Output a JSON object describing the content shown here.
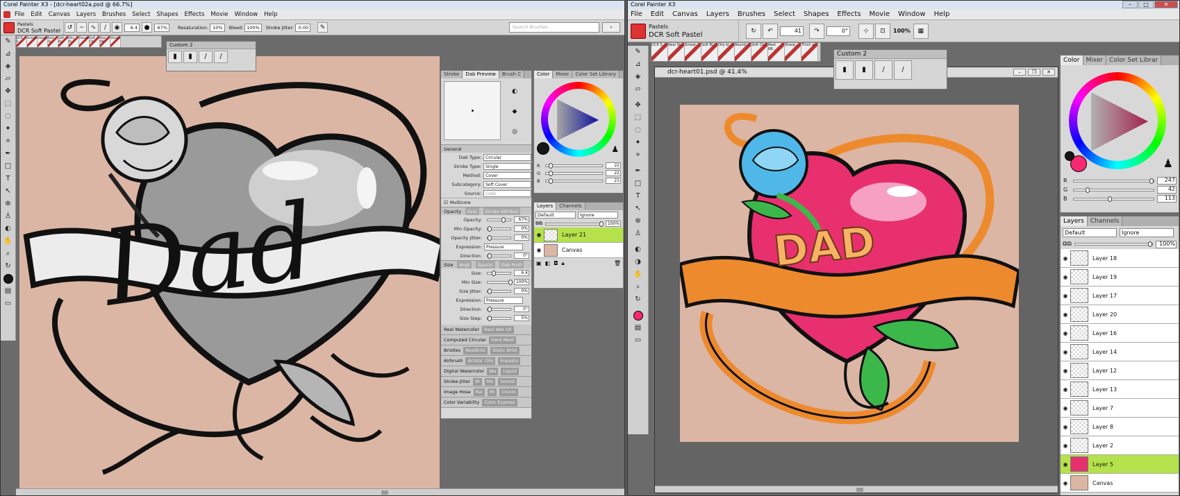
{
  "left_window": {
    "title": "Corel Painter X3 - [dcr-heart02a.psd @ 66.7%]",
    "menu": [
      "File",
      "Edit",
      "Canvas",
      "Layers",
      "Brushes",
      "Select",
      "Shapes",
      "Effects",
      "Movie",
      "Window",
      "Help"
    ],
    "brush_category": "Pastels",
    "brush_variant": "DCR Soft Pastel",
    "property_bar": {
      "size": "6.4",
      "opacity": "67%",
      "resaturation_label": "Resaturation:",
      "resaturation": "10%",
      "bleed_label": "Bleed:",
      "bleed": "100%",
      "stroke_jitter_label": "Stroke Jitter:",
      "stroke_jitter": "0.00"
    },
    "search_placeholder": "Search Brushes",
    "brush_strip": [
      "DCR S...",
      "Scissors",
      "Smear",
      "Real St...",
      "Soft Bl...",
      "Oily bl...",
      "Round...",
      "Soft Ch...",
      "Real 6B...",
      "Sharp..."
    ],
    "custom_palette_title": "Custom 2",
    "canvas_text": "Dad",
    "canvas_bg": "#dcb6a4",
    "brush_control_tabs": [
      "Stroke",
      "Dab Preview",
      "Brush C"
    ],
    "general": {
      "title": "General",
      "rows": [
        {
          "label": "Dab Type:",
          "value": "Circular"
        },
        {
          "label": "Stroke Type:",
          "value": "Single"
        },
        {
          "label": "Method:",
          "value": "Cover"
        },
        {
          "label": "Subcategory:",
          "value": "Soft Cover"
        },
        {
          "label": "Source:",
          "value": "Color"
        }
      ],
      "multicore": "Multicore"
    },
    "opacity_section": {
      "tabs": [
        "Opacity",
        "Grai",
        "Stroke Attribut"
      ],
      "rows": [
        {
          "label": "Opacity:",
          "value": "67%",
          "pos": 0.67
        },
        {
          "label": "Min Opacity:",
          "value": "0%",
          "pos": 0
        },
        {
          "label": "Opacity Jitter:",
          "value": "0%",
          "pos": 0
        }
      ],
      "expression_label": "Expression:",
      "expression": "Pressure",
      "direction_label": "Direction:",
      "direction": "0°"
    },
    "size_section": {
      "tabs": [
        "Size",
        "Angl",
        "Spacin",
        "Dab Profi"
      ],
      "rows": [
        {
          "label": "Size:",
          "value": "6.4",
          "pos": 0.2
        },
        {
          "label": "Min Size:",
          "value": "100%",
          "pos": 1
        },
        {
          "label": "Size Jitter:",
          "value": "0%",
          "pos": 0
        }
      ],
      "expression_label": "Expression:",
      "expression": "Pressure",
      "direction_label": "Direction:",
      "direction": "0°",
      "size_step_label": "Size Step:",
      "size_step": "5%"
    },
    "collapsed_sections": [
      [
        "Real Watercolor",
        "Real Wet Oil"
      ],
      [
        "Computed Circular",
        "Hard Medi"
      ],
      [
        "Bristles",
        "RealBrist",
        "Static Brist"
      ],
      [
        "Airbrush",
        "Artists' Oils",
        "Impasto"
      ],
      [
        "Digital Watercolor",
        "Wa",
        "Liquid"
      ],
      [
        "Stroke Jitter",
        "W",
        "Mo",
        "Smoot"
      ],
      [
        "Image Hose",
        "Ral",
        "Mi",
        "Clonin"
      ],
      [
        "Color Variability",
        "Color Express"
      ]
    ],
    "color_tabs": [
      "Color",
      "Mixer",
      "Color Set Library"
    ],
    "rgb": {
      "r": "22",
      "g": "22",
      "b": "21"
    },
    "layers_tabs": [
      "Layers",
      "Channels"
    ],
    "composite_method": "Default",
    "composite_depth": "Ignore",
    "layer_opacity": "100%",
    "layers": [
      {
        "name": "Layer 21",
        "selected": true
      },
      {
        "name": "Canvas",
        "selected": false
      }
    ]
  },
  "right_window": {
    "title": "Corel Painter X3",
    "menu": [
      "File",
      "Edit",
      "Canvas",
      "Layers",
      "Brushes",
      "Select",
      "Shapes",
      "Effects",
      "Movie",
      "Window",
      "Help"
    ],
    "brush_category": "Pastels",
    "brush_variant": "DCR Soft Pastel",
    "property_bar": {
      "angle1": "41",
      "angle2": "0°",
      "zoom": "100%"
    },
    "brush_strip": [
      "DCR S...",
      "Real St...",
      "Smear",
      "Soft Bl...",
      "Oily bl...",
      "Round...",
      "Soft Ch...",
      "Real 6B...",
      "Sharp...",
      "Thick a..."
    ],
    "custom_palette_title": "Custom 2",
    "doc_title": "dcr-heart01.psd @ 41.4%",
    "canvas_text": "DAD",
    "canvas_bg": "#dcb6a4",
    "color_tabs": [
      "Color",
      "Mixer",
      "Color Set Librar"
    ],
    "rgb": {
      "r": "247",
      "g": "42",
      "b": "113"
    },
    "layers_tabs": [
      "Layers",
      "Channels"
    ],
    "composite_method": "Default",
    "composite_depth": "Ignore",
    "layer_opacity": "100%",
    "layers": [
      {
        "name": "Layer 18",
        "selected": false
      },
      {
        "name": "Layer 19",
        "selected": false
      },
      {
        "name": "Layer 17",
        "selected": false
      },
      {
        "name": "Layer 20",
        "selected": false
      },
      {
        "name": "Layer 16",
        "selected": false
      },
      {
        "name": "Layer 14",
        "selected": false
      },
      {
        "name": "Layer 12",
        "selected": false
      },
      {
        "name": "Layer 13",
        "selected": false
      },
      {
        "name": "Layer 7",
        "selected": false
      },
      {
        "name": "Layer 8",
        "selected": false
      },
      {
        "name": "Layer 2",
        "selected": false
      },
      {
        "name": "Layer 5",
        "selected": true
      },
      {
        "name": "Canvas",
        "selected": false
      }
    ]
  },
  "colors": {
    "selected_layer": "#b5e24c",
    "main_color_left": "#161615",
    "main_color_right": "#f72a71",
    "rose_right": "#4fb8e8",
    "heart_right": "#e8306e",
    "ribbon_right": "#ee8a2e",
    "leaf_right": "#3cb84a"
  },
  "icons": [
    "brush-icon",
    "eyedropper-icon",
    "paint-bucket-icon",
    "eraser-icon",
    "layer-adjuster-icon",
    "rectangle-select-icon",
    "lasso-icon",
    "magic-wand-icon",
    "crop-icon",
    "pen-icon",
    "shape-icon",
    "text-icon",
    "pointer-icon",
    "cloner-icon",
    "rubber-stamp-icon",
    "dodge-icon",
    "burn-icon",
    "grabber-icon",
    "magnifier-icon",
    "rotate-page-icon",
    "eye-icon",
    "search-icon"
  ]
}
